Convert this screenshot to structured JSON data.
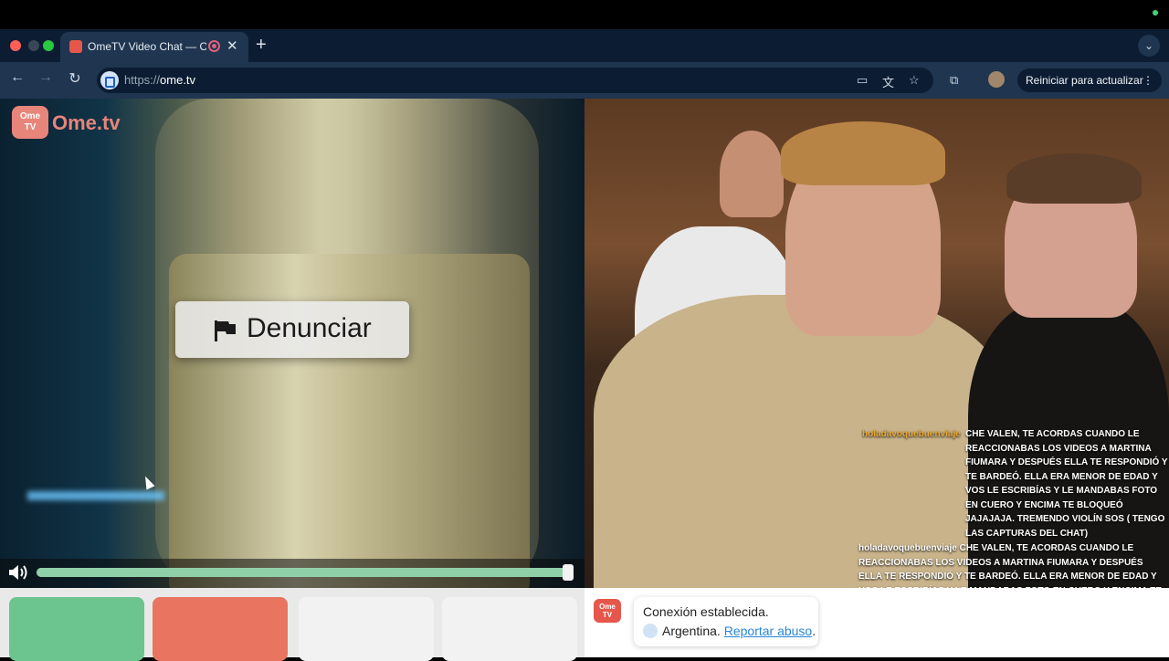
{
  "browser": {
    "tab_title": "OmeTV Video Chat — Ome",
    "url_prefix": "https://",
    "url_host": "ome.tv",
    "update_button": "Reiniciar para actualizar",
    "new_tab_glyph": "+",
    "close_glyph": "✕",
    "menu_glyph": "⋮",
    "back_glyph": "←",
    "forward_glyph": "→",
    "reload_glyph": "↻",
    "tab_search_glyph": "⌄"
  },
  "app": {
    "logo_badge": "Ome\nTV",
    "logo_text": "Ome.tv",
    "report_button": "Denunciar",
    "volume_level": 1.0,
    "volume_glyph": "🔈",
    "accent_green": "#8fd0a8",
    "accent_red": "#e5574b"
  },
  "chat": [
    {
      "user": "holadavoquebuenviaje",
      "text": "CHE VALEN, TE ACORDAS CUANDO LE REACCIONABAS LOS VIDEOS A MARTINA FIUMARA Y DESPUÉS ELLA TE RESPONDIÓ Y TE BARDEÓ. ELLA ERA MENOR DE EDAD Y VOS LE ESCRIBÍAS Y LE MANDABAS FOTO EN CUERO Y ENCIMA TE BLOQUEÓ JAJAJAJA. TREMENDO VIOLÍN SOS ( TENGO LAS CAPTURAS DEL CHAT)"
    },
    {
      "user": "holadavoquebuenviaje",
      "text": "CHE VALEN, TE ACORDAS CUANDO LE REACCIONABAS LOS VIDEOS A MARTINA FIUMARA Y DESPUÉS ELLA TE RESPONDIÓ Y TE BARDEÓ. ELLA ERA MENOR DE EDAD Y VOS LE ESCRIBÍAS Y LE MANDABAS FOTO EN CUERO Y ENCIMA TE BLOQUEÓ JAJAJAJA. TREMENDO VIOLÍN SOS ( TENGO LAS CAPTURAS DEL CHAT)"
    }
  ],
  "connection": {
    "logo_badge": "Ome\nTV",
    "status": "Conexión establecida.",
    "country": "Argentina.",
    "report_link": "Reportar abuso",
    "period": "."
  },
  "bottom_buttons": [
    {
      "name": "next-button",
      "color": "#6cc48e"
    },
    {
      "name": "stop-button",
      "color": "#e9745f"
    },
    {
      "name": "option-button-1",
      "color": "#f2f2f2"
    },
    {
      "name": "option-button-2",
      "color": "#f2f2f2"
    }
  ]
}
